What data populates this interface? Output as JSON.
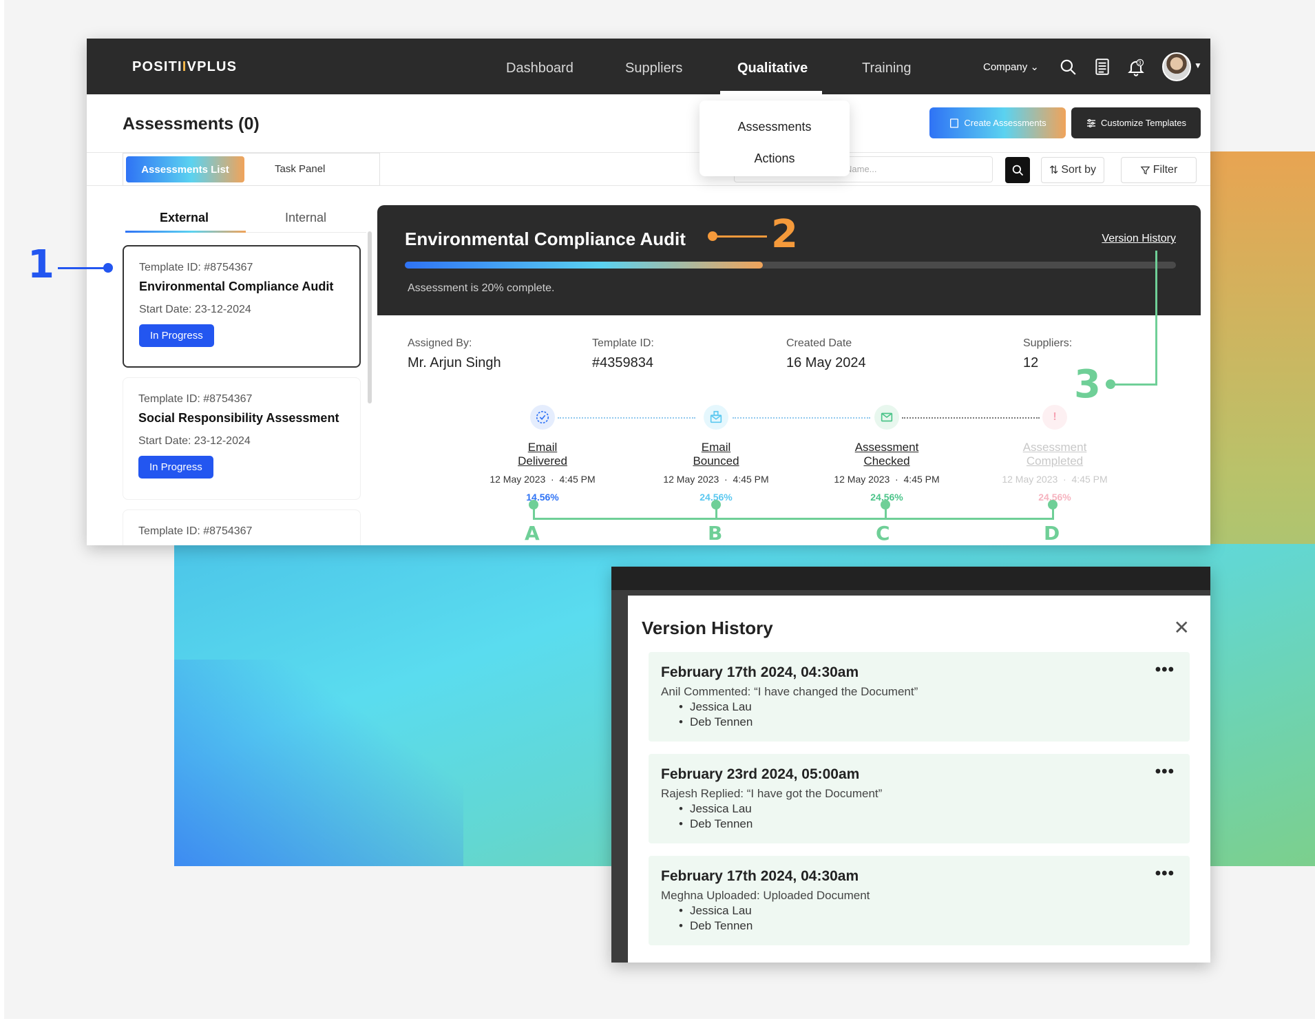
{
  "brand": {
    "logo_prefix": "POSITI",
    "logo_bars": "I",
    "logo_suffix": "VPLUS"
  },
  "nav": {
    "items": [
      "Dashboard",
      "Suppliers",
      "Qualitative",
      "Training"
    ],
    "active": "Qualitative",
    "company_label": "Company",
    "notification_count": "3"
  },
  "qualitative_menu": [
    "Assessments",
    "Actions"
  ],
  "page": {
    "title": "Assessments (0)",
    "create_label": "Create Assessments",
    "customize_label": "Customize Templates",
    "view_tabs": [
      "Assessments List",
      "Task Panel"
    ],
    "search_placeholder": "Name...",
    "sort_label": "Sort by",
    "filter_label": "Filter"
  },
  "list_tabs": [
    "External",
    "Internal"
  ],
  "cards": [
    {
      "template_id": "Template ID: #8754367",
      "title": "Environmental Compliance Audit",
      "start_date": "Start Date: 23-12-2024",
      "status": "In Progress"
    },
    {
      "template_id": "Template ID: #8754367",
      "title": "Social Responsibility Assessment",
      "start_date": "Start Date: 23-12-2024",
      "status": "In Progress"
    },
    {
      "template_id": "Template ID: #8754367"
    }
  ],
  "detail": {
    "title": "Environmental Compliance Audit",
    "version_history_link": "Version History",
    "progress_percent": 20,
    "progress_text": "Assessment is 20% complete.",
    "meta": [
      {
        "label": "Assigned By:",
        "value": "Mr. Arjun Singh"
      },
      {
        "label": "Template ID:",
        "value": "#4359834"
      },
      {
        "label": "Created Date",
        "value": "16 May 2024"
      },
      {
        "label": "Suppliers:",
        "value": "12"
      }
    ],
    "steps": [
      {
        "name_line1": "Email",
        "name_line2": "Delivered",
        "date": "12 May 2023",
        "time": "4:45 PM",
        "percent": "14.56%",
        "color": "#2f73f5"
      },
      {
        "name_line1": "Email",
        "name_line2": "Bounced",
        "date": "12 May 2023",
        "time": "4:45 PM",
        "percent": "24.56%",
        "color": "#5bc8f0"
      },
      {
        "name_line1": "Assessment",
        "name_line2": "Checked",
        "date": "12 May 2023",
        "time": "4:45 PM",
        "percent": "24.56%",
        "color": "#4cc48a"
      },
      {
        "name_line1": "Assessment",
        "name_line2": "Completed",
        "date": "12 May 2023",
        "time": "4:45 PM",
        "percent": "24.56%",
        "color": "#f6b3bf"
      }
    ]
  },
  "annotations": {
    "markers": [
      "1",
      "2",
      "3"
    ],
    "letters": [
      "A",
      "B",
      "C",
      "D"
    ],
    "colors": {
      "one": "#2356f0",
      "two": "#f59a3b",
      "three": "#6fcf97"
    }
  },
  "version_history": {
    "title": "Version History",
    "entries": [
      {
        "date": "February 17th 2024,  04:30am",
        "message": "Anil Commented:  “I have changed the Document”",
        "people": [
          "Jessica Lau",
          "Deb Tennen"
        ]
      },
      {
        "date": "February 23rd 2024,  05:00am",
        "message": "Rajesh Replied: “I have got the Document”",
        "people": [
          "Jessica Lau",
          "Deb Tennen"
        ]
      },
      {
        "date": "February 17th 2024,  04:30am",
        "message": "Meghna Uploaded:  Uploaded Document",
        "people": [
          "Jessica Lau",
          "Deb Tennen"
        ]
      }
    ]
  },
  "colors": {
    "accent": "#2356f0",
    "dark": "#2b2b2b",
    "entry_bg": "#eff8f2"
  }
}
